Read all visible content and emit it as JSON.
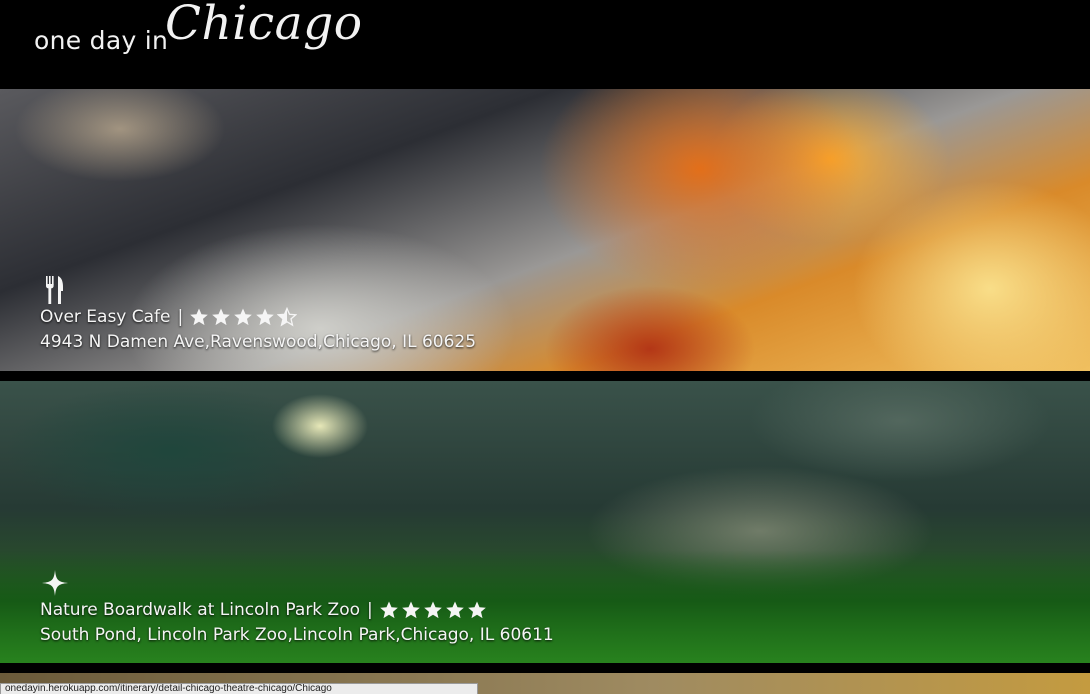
{
  "header": {
    "brand_prefix": "one day in",
    "brand_city": "Chicago"
  },
  "cards": [
    {
      "category_icon": "fork-knife-icon",
      "name": "Over Easy Cafe",
      "separator": "|",
      "rating": 4.5,
      "address": "4943 N Damen Ave,Ravenswood,Chicago, IL 60625"
    },
    {
      "category_icon": "sparkle-icon",
      "name": "Nature Boardwalk at Lincoln Park Zoo",
      "separator": "|",
      "rating": 5,
      "address": "South Pond, Lincoln Park Zoo,Lincoln Park,Chicago, IL 60611"
    }
  ],
  "status_bar": {
    "url": "onedayin.herokuapp.com/itinerary/detail-chicago-theatre-chicago/Chicago"
  },
  "colors": {
    "header_bg": "#000000",
    "text": "#f5f5f5"
  }
}
